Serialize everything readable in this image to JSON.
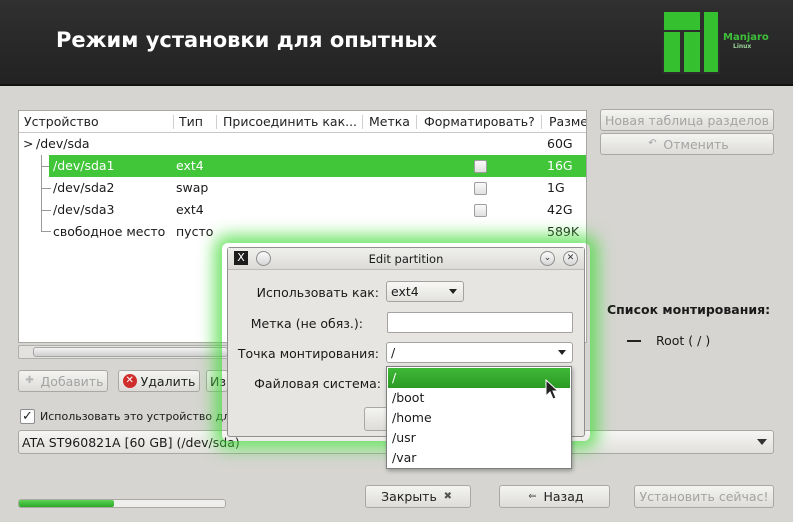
{
  "header": {
    "title": "Режим установки для опытных",
    "logo_text": "Manjaro",
    "logo_sub": "Linux"
  },
  "tree": {
    "columns": [
      "Устройство",
      "Тип",
      "Присоединить как...",
      "Метка",
      "Форматировать?",
      "Разме"
    ],
    "rows": [
      {
        "device": "/dev/sda",
        "type": "",
        "size": "60G"
      },
      {
        "device": "/dev/sda1",
        "type": "ext4",
        "size": "16G"
      },
      {
        "device": "/dev/sda2",
        "type": "swap",
        "size": "1G"
      },
      {
        "device": "/dev/sda3",
        "type": "ext4",
        "size": "42G"
      },
      {
        "device": "свободное место",
        "type": "пусто",
        "size": "589K"
      }
    ],
    "expander": ">"
  },
  "side_buttons": {
    "new_table": "Новая таблица разделов",
    "undo": "Отменить"
  },
  "actions": {
    "add": "Добавить",
    "delete": "Удалить",
    "edit_peek": "Из"
  },
  "use_device": {
    "label": "Использовать это устройство дл",
    "checked": "✓"
  },
  "device_select": {
    "value": "ATA ST960821A [60 GB] (/dev/sda)"
  },
  "mount_list": {
    "title": "Список монтирования:",
    "items": [
      "Root ( / )"
    ]
  },
  "dialog": {
    "title": "Edit partition",
    "close_glyph": "X",
    "use_as_label": "Использовать как:",
    "use_as_value": "ext4",
    "label_label": "Метка (не обяз.):",
    "mount_label": "Точка монтирования:",
    "mount_value": "/",
    "fs_label": "Файловая система:"
  },
  "mount_dropdown": {
    "options": [
      "/",
      "/boot",
      "/home",
      "/usr",
      "/var"
    ],
    "highlighted": "/"
  },
  "progress": {
    "fraction": 0.46
  },
  "bottom_buttons": {
    "close": "Закрыть",
    "back": "Назад",
    "install": "Установить сейчас!"
  },
  "colors": {
    "accent": "#41c63a",
    "header_bg": "#2a2a2a",
    "glow": "#46dc3c"
  }
}
